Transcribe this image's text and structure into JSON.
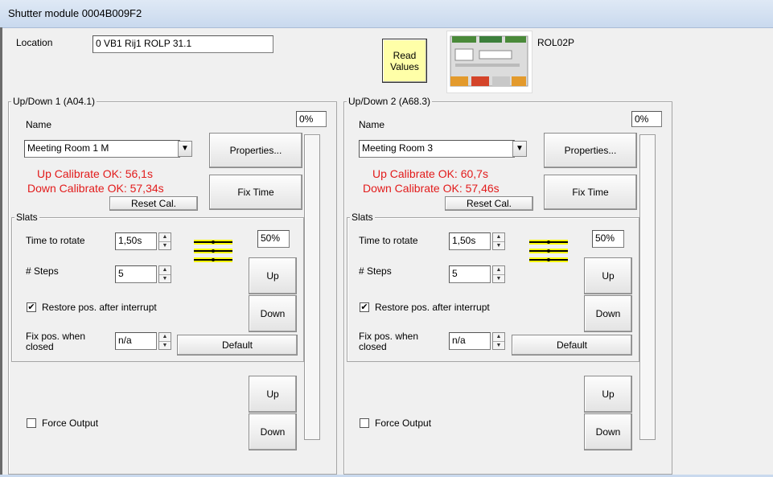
{
  "window": {
    "title": "Shutter module 0004B009F2"
  },
  "header": {
    "location_label": "Location",
    "location_value": "0 VB1 Rij1 ROLP 31.1",
    "read_values_label_line1": "Read",
    "read_values_label_line2": "Values",
    "model": "ROL02P"
  },
  "panels": [
    {
      "title": "Up/Down 1 (A04.1)",
      "percent": "0%",
      "name_label": "Name",
      "name_value": "Meeting Room 1 M",
      "properties_label": "Properties...",
      "up_calibrate": "Up Calibrate OK: 56,1s",
      "down_calibrate": "Down Calibrate OK: 57,34s",
      "fix_time_label": "Fix Time",
      "reset_cal_label": "Reset Cal.",
      "slats": {
        "title": "Slats",
        "time_to_rotate_label": "Time to rotate",
        "time_to_rotate_value": "1,50s",
        "steps_label": "# Steps",
        "steps_value": "5",
        "slat_percent": "50%",
        "up_label": "Up",
        "down_label": "Down",
        "restore_label": "Restore pos. after interrupt",
        "restore_checked": true,
        "fix_pos_label_line1": "Fix pos. when",
        "fix_pos_label_line2": "closed",
        "fix_pos_value": "n/a",
        "default_label": "Default"
      },
      "force_output_label": "Force Output",
      "force_output_checked": false,
      "up_label": "Up",
      "down_label": "Down"
    },
    {
      "title": "Up/Down 2 (A68.3)",
      "percent": "0%",
      "name_label": "Name",
      "name_value": "Meeting Room 3",
      "properties_label": "Properties...",
      "up_calibrate": "Up Calibrate OK: 60,7s",
      "down_calibrate": "Down Calibrate OK: 57,46s",
      "fix_time_label": "Fix Time",
      "reset_cal_label": "Reset Cal.",
      "slats": {
        "title": "Slats",
        "time_to_rotate_label": "Time to rotate",
        "time_to_rotate_value": "1,50s",
        "steps_label": "# Steps",
        "steps_value": "5",
        "slat_percent": "50%",
        "up_label": "Up",
        "down_label": "Down",
        "restore_label": "Restore pos. after interrupt",
        "restore_checked": true,
        "fix_pos_label_line1": "Fix pos. when",
        "fix_pos_label_line2": "closed",
        "fix_pos_value": "n/a",
        "default_label": "Default"
      },
      "force_output_label": "Force Output",
      "force_output_checked": false,
      "up_label": "Up",
      "down_label": "Down"
    }
  ],
  "colors": {
    "calibrate_text": "#e21b1b",
    "read_values_bg": "#ffffa8",
    "slat_yellow": "#ffff00"
  }
}
